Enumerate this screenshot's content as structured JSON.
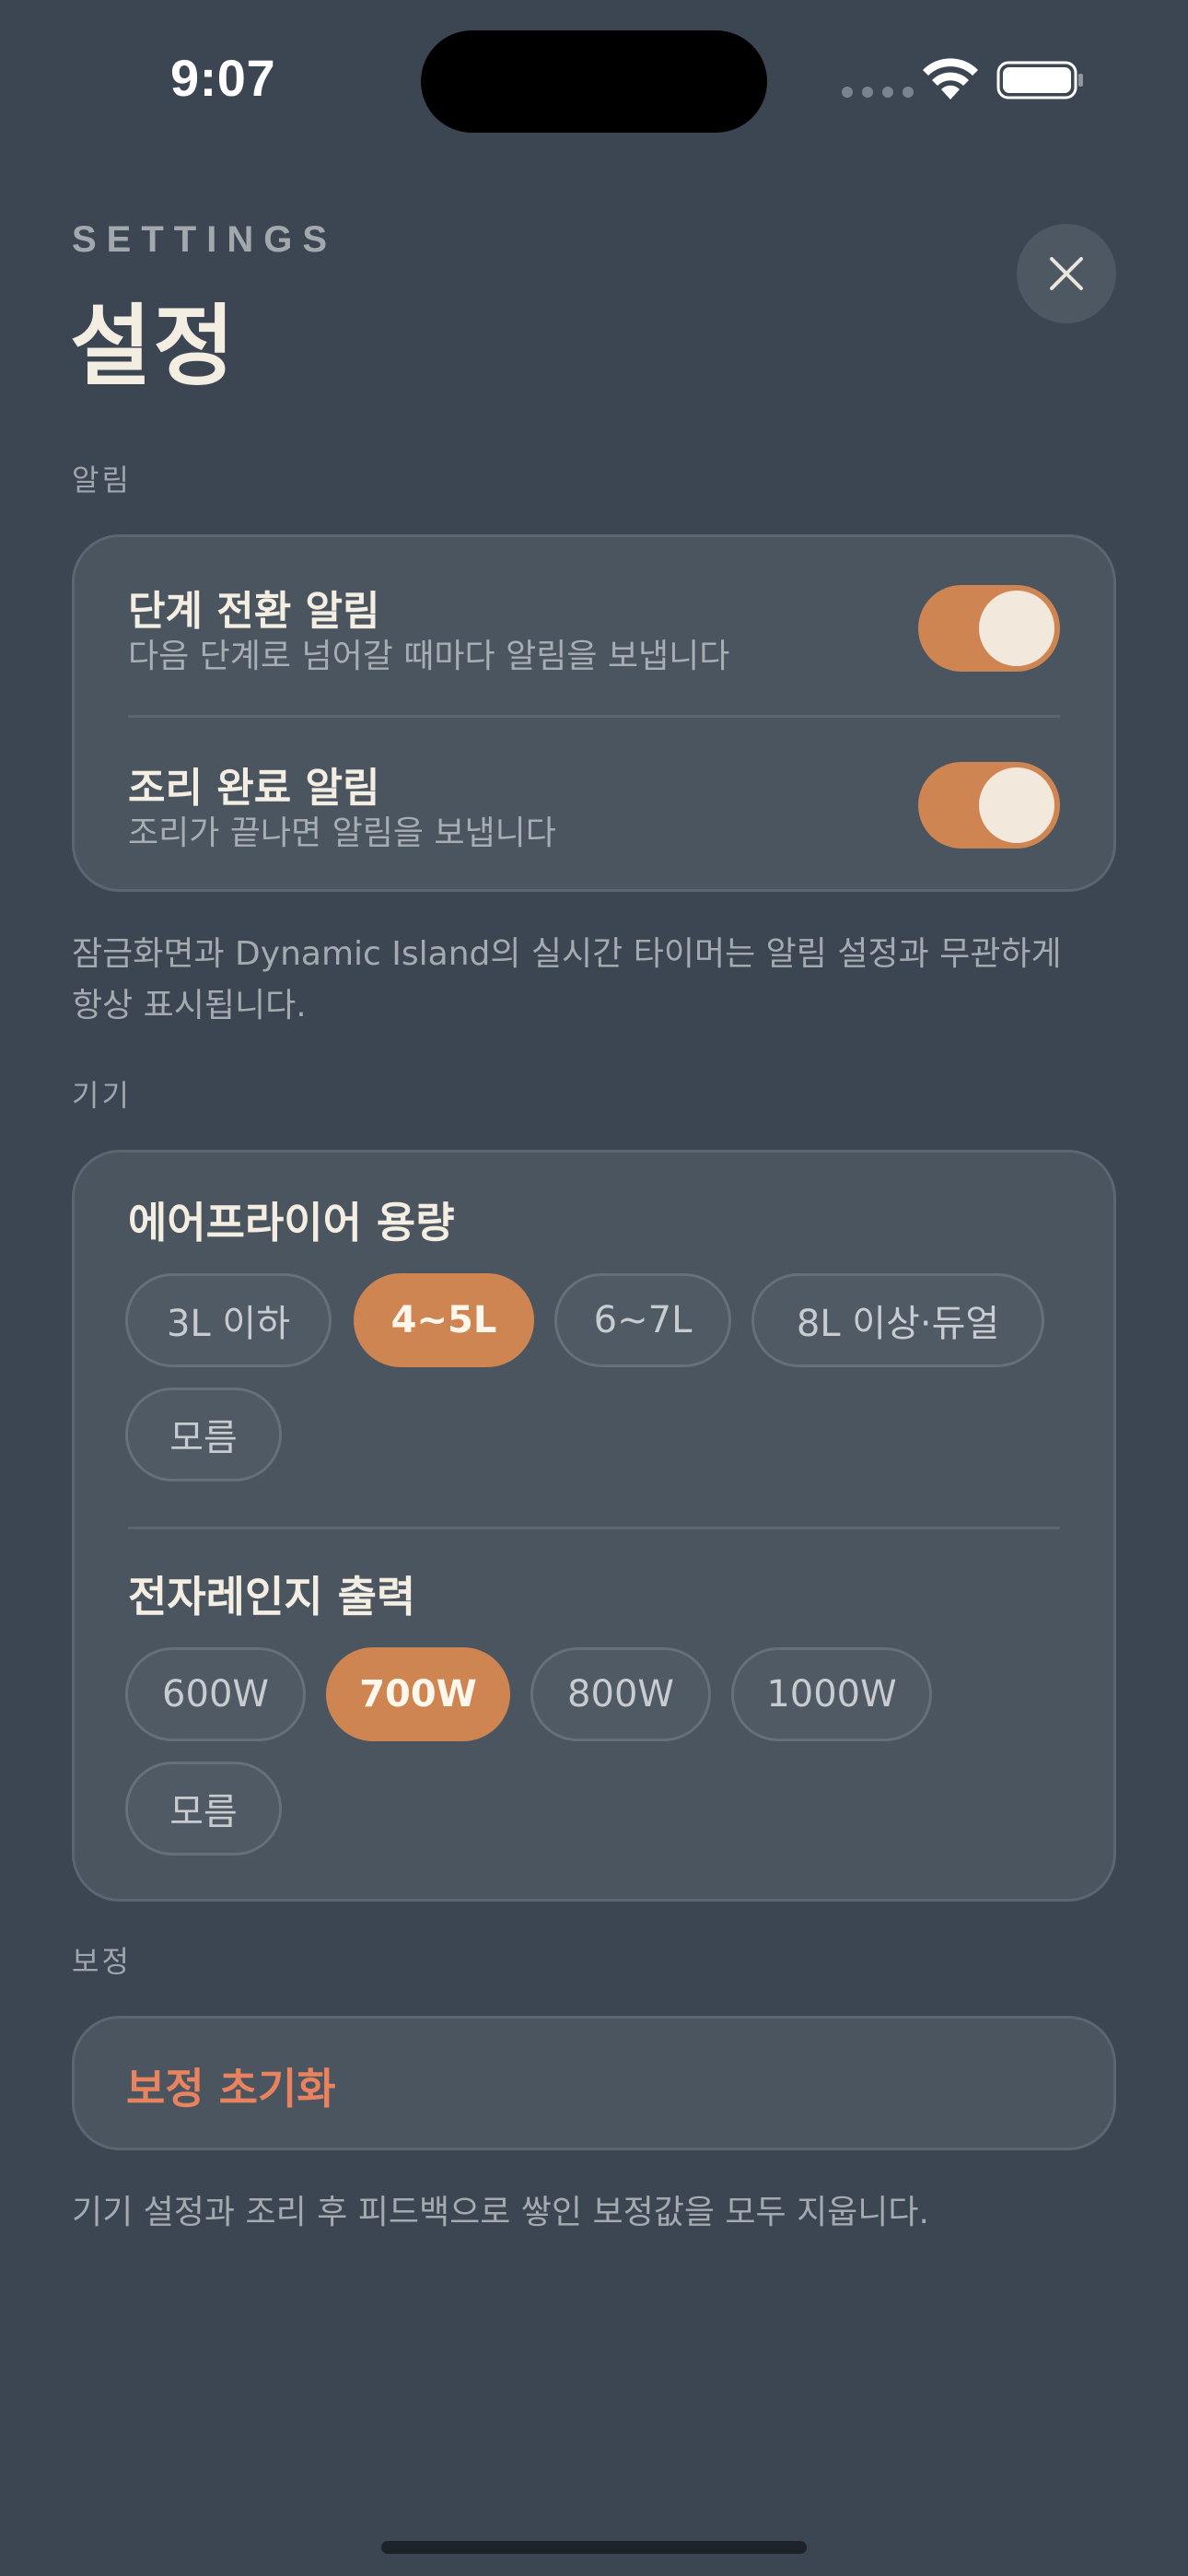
{
  "status_bar": {
    "time": "9:07"
  },
  "header": {
    "eyebrow": "SETTINGS",
    "title": "설정",
    "close_icon": "close-icon"
  },
  "notifications": {
    "section_label": "알림",
    "rows": [
      {
        "title": "단계 전환 알림",
        "subtitle": "다음 단계로 넘어갈 때마다 알림을 보냅니다",
        "enabled": true
      },
      {
        "title": "조리 완료 알림",
        "subtitle": "조리가 끝나면 알림을 보냅니다",
        "enabled": true
      }
    ],
    "note_line1": "잠금화면과 Dynamic Island의 실시간 타이머는 알림 설정과 무관하게",
    "note_line2": "항상 표시됩니다."
  },
  "devices": {
    "section_label": "기기",
    "airfryer": {
      "title": "에어프라이어 용량",
      "options": [
        "3L 이하",
        "4~5L",
        "6~7L",
        "8L 이상·듀얼",
        "모름"
      ],
      "selected": "4~5L"
    },
    "microwave": {
      "title": "전자레인지 출력",
      "options": [
        "600W",
        "700W",
        "800W",
        "1000W",
        "모름"
      ],
      "selected": "700W"
    }
  },
  "calibration": {
    "section_label": "보정",
    "reset_label": "보정 초기화",
    "note": "기기 설정과 조리 후 피드백으로 쌓인 보정값을 모두 지웁니다."
  },
  "colors": {
    "background": "#3b4652",
    "card": "#4a5560",
    "accent": "#cf8552",
    "destructive": "#e8825f"
  }
}
